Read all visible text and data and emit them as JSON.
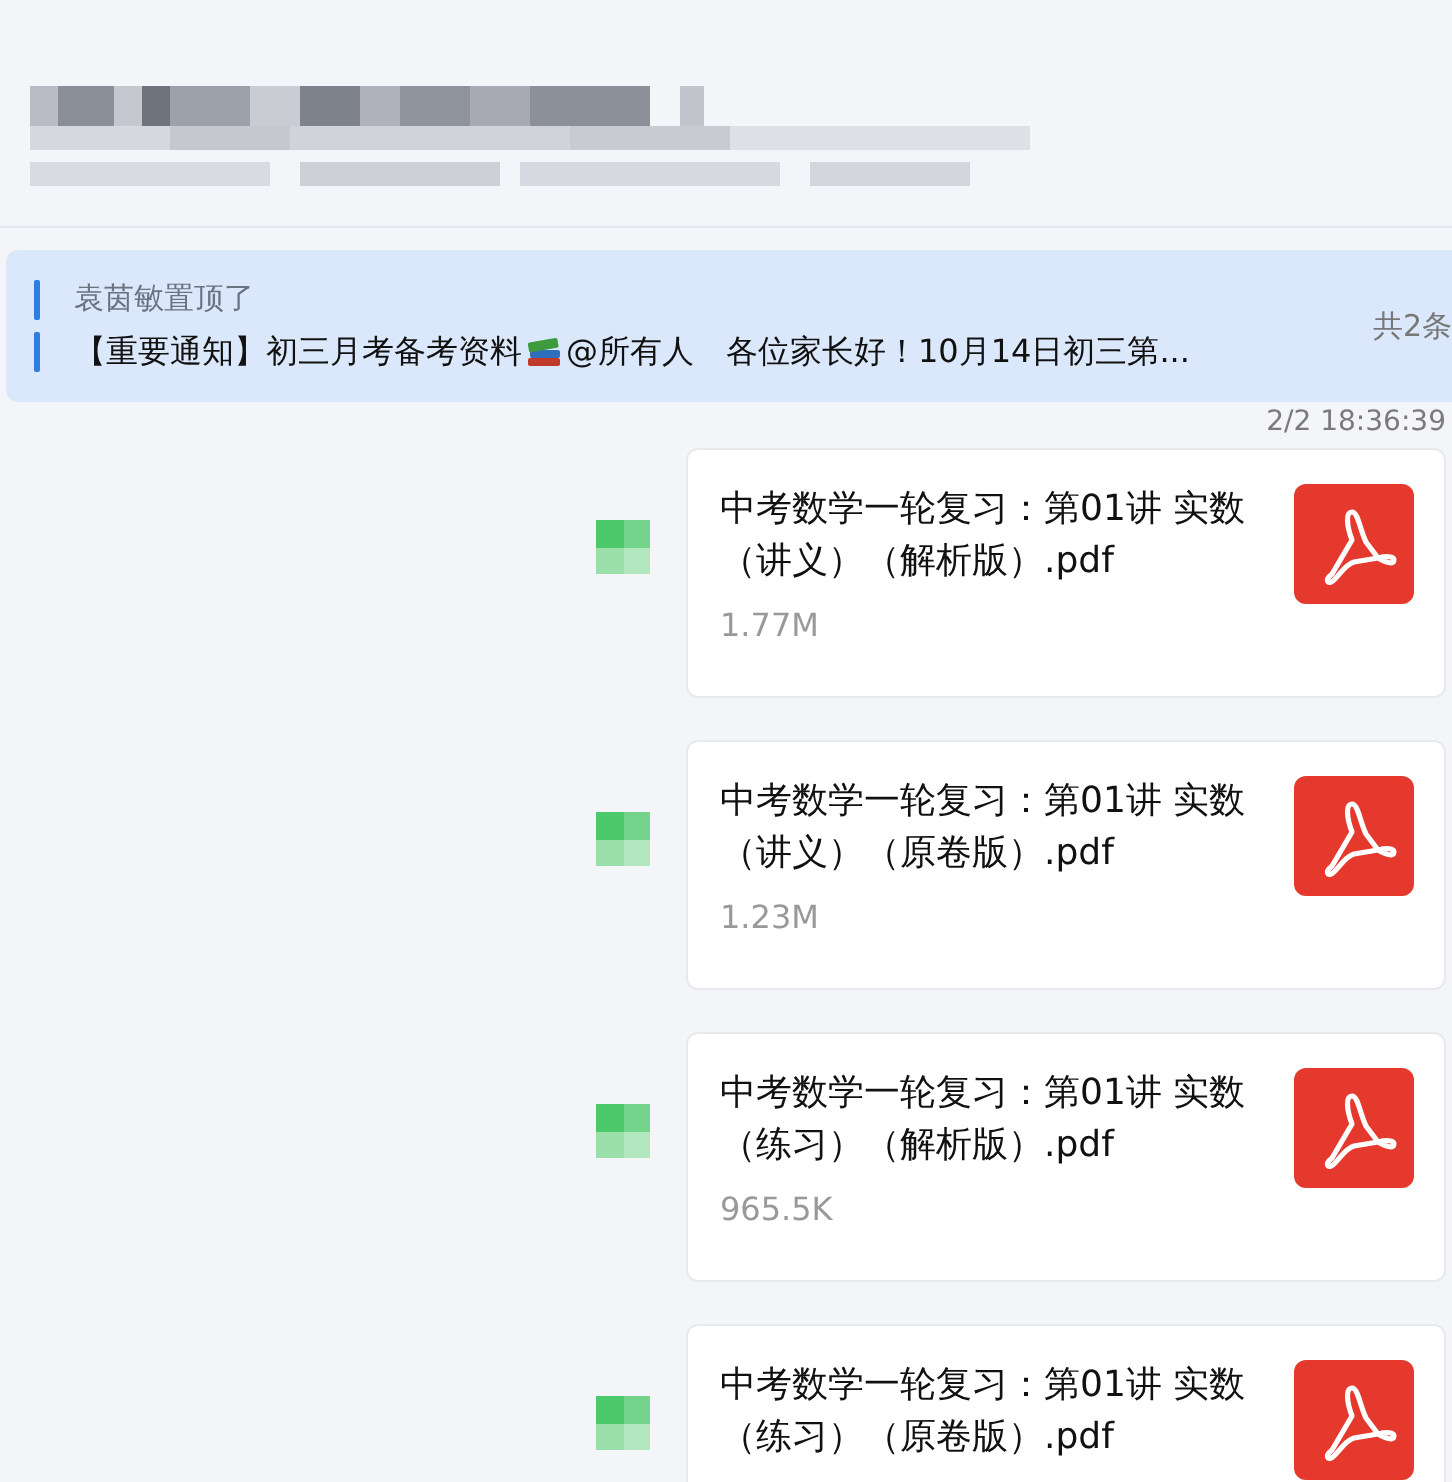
{
  "pinned": {
    "by": "袁茵敏置顶了",
    "text_before": "【重要通知】初三月考备考资料",
    "text_after": "@所有人　各位家长好！10月14日初三第...",
    "count": "共2条"
  },
  "messages": [
    {
      "time": "2/2 18:36:39",
      "file_name": "中考数学一轮复习：第01讲 实数（讲义）（解析版）.pdf",
      "size": "1.77M"
    },
    {
      "file_name": "中考数学一轮复习：第01讲 实数（讲义）（原卷版）.pdf",
      "size": "1.23M"
    },
    {
      "file_name": "中考数学一轮复习：第01讲 实数（练习）（解析版）.pdf",
      "size": "965.5K"
    },
    {
      "file_name": "中考数学一轮复习：第01讲 实数（练习）（原卷版）.pdf"
    }
  ]
}
